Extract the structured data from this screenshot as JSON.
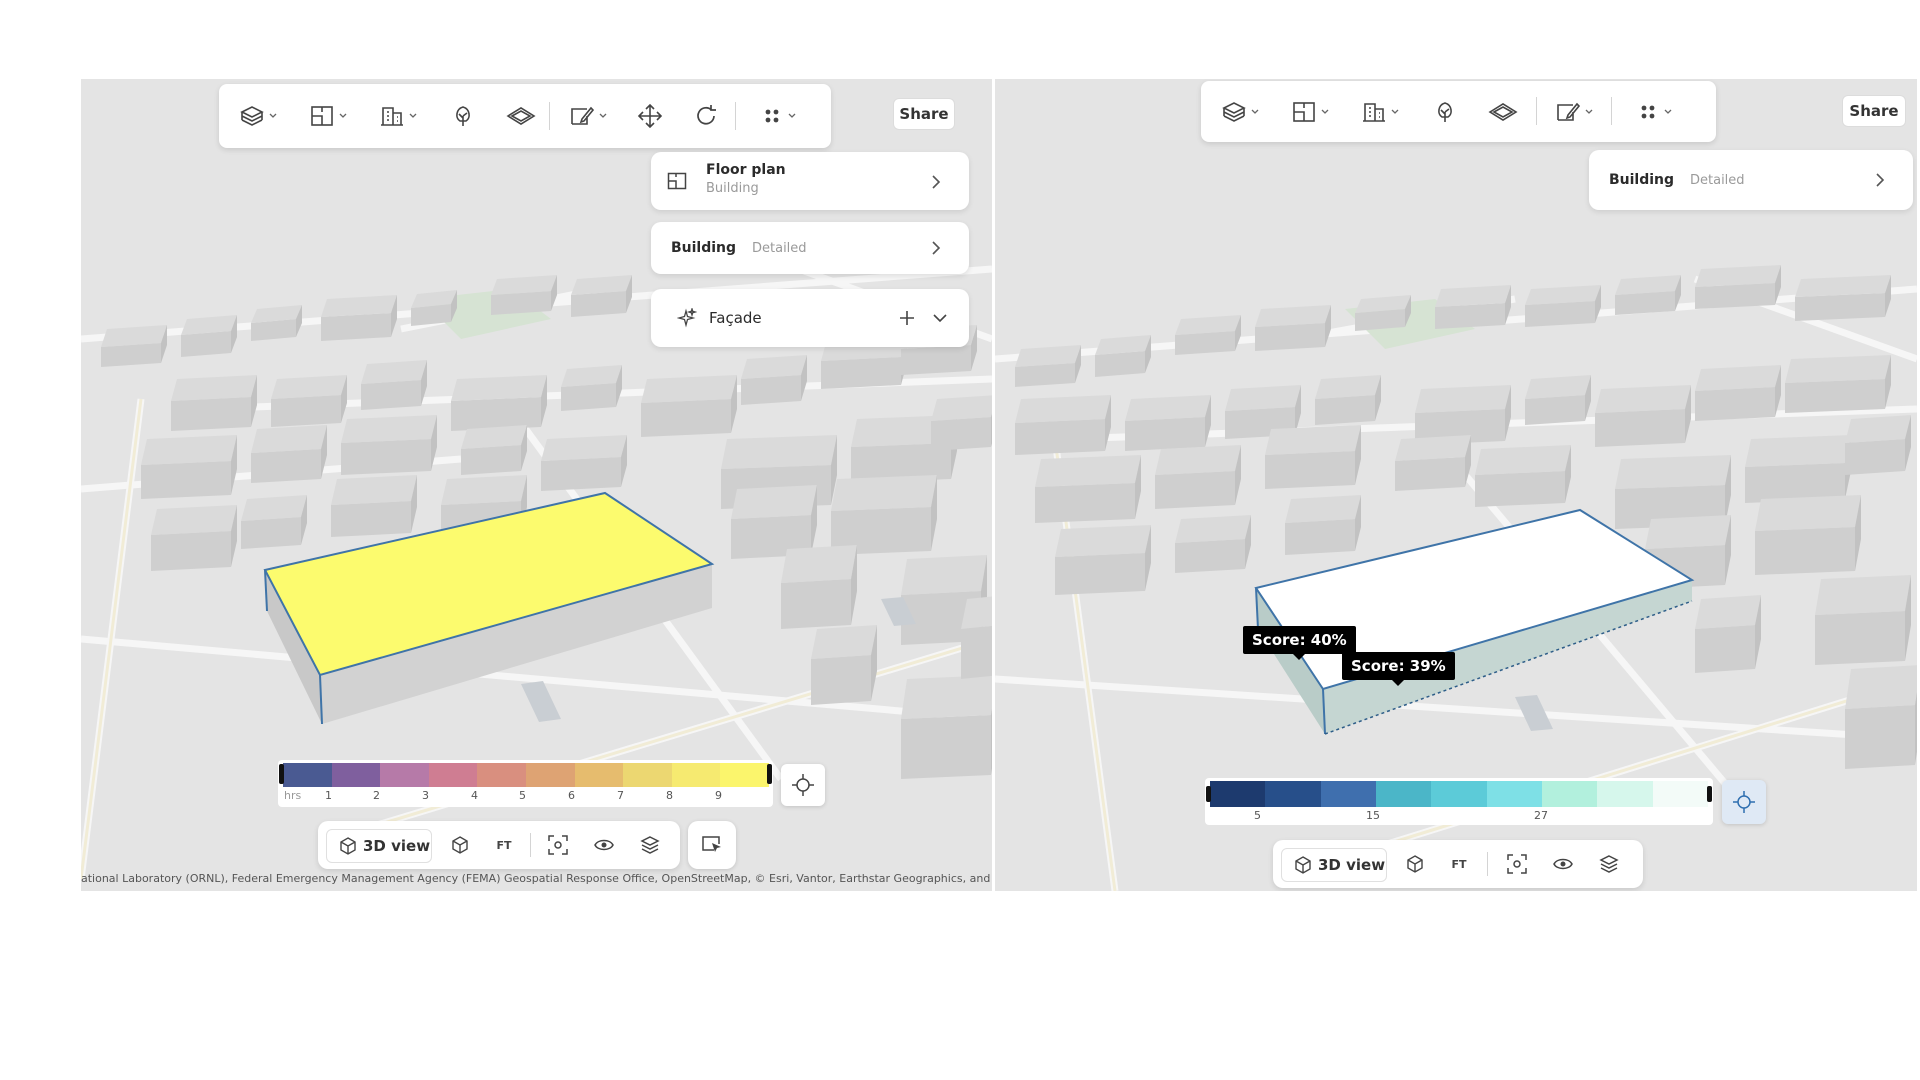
{
  "left_panel": {
    "toolbar": {
      "tools": [
        {
          "icon": "layers-cube-icon",
          "has_menu": true
        },
        {
          "icon": "floor-plan-icon",
          "has_menu": true
        },
        {
          "icon": "building-icon",
          "has_menu": true
        },
        {
          "icon": "tree-icon",
          "has_menu": false
        },
        {
          "icon": "surface-icon",
          "has_menu": false
        },
        {
          "icon": "edit-shape-icon",
          "has_menu": true
        },
        {
          "icon": "move-icon",
          "has_menu": false
        },
        {
          "icon": "rotate-icon",
          "has_menu": false
        },
        {
          "icon": "more-dots-icon",
          "has_menu": true
        }
      ],
      "share_label": "Share"
    },
    "cards": {
      "floor_plan": {
        "title": "Floor plan",
        "subtitle": "Building"
      },
      "building": {
        "title": "Building",
        "subtitle": "Detailed"
      },
      "facade": {
        "title": "Façade"
      }
    },
    "legend": {
      "unit": "hrs",
      "ticks": [
        "1",
        "2",
        "3",
        "4",
        "5",
        "6",
        "7",
        "8",
        "9"
      ],
      "colors": [
        "#4a5a92",
        "#7f5f9e",
        "#b67aa8",
        "#cf7d92",
        "#d98f7f",
        "#dea373",
        "#e6bc6e",
        "#ecd771",
        "#f6ea70",
        "#fbf56c"
      ]
    },
    "bottom_bar": {
      "view_label": "3D view",
      "ft_label": "FT"
    },
    "attribution": "ational Laboratory (ORNL), Federal Emergency Management Agency (FEMA) Geospatial Response Office, OpenStreetMap, © Esri, Vantor, Earthstar Geographics, and the GIS User",
    "highlight_color": "#fcfb6e"
  },
  "right_panel": {
    "toolbar": {
      "tools": [
        {
          "icon": "layers-cube-icon",
          "has_menu": true
        },
        {
          "icon": "floor-plan-icon",
          "has_menu": true
        },
        {
          "icon": "building-icon",
          "has_menu": true
        },
        {
          "icon": "tree-icon",
          "has_menu": false
        },
        {
          "icon": "surface-icon",
          "has_menu": false
        },
        {
          "icon": "edit-shape-icon",
          "has_menu": true
        },
        {
          "icon": "more-dots-icon",
          "has_menu": true
        }
      ],
      "share_label": "Share"
    },
    "cards": {
      "building": {
        "title": "Building",
        "subtitle": "Detailed"
      }
    },
    "tooltips": [
      "Score: 40%",
      "Score: 39%"
    ],
    "legend": {
      "ticks": [
        "5",
        "15",
        "27"
      ],
      "colors": [
        "#1d3a6e",
        "#274f8a",
        "#3f6fae",
        "#4bb6c8",
        "#5ccbd8",
        "#7ee0e6",
        "#b2f0dd",
        "#d6f7ec",
        "#f3fbf8"
      ]
    },
    "bottom_bar": {
      "view_label": "3D view",
      "ft_label": "FT"
    }
  }
}
